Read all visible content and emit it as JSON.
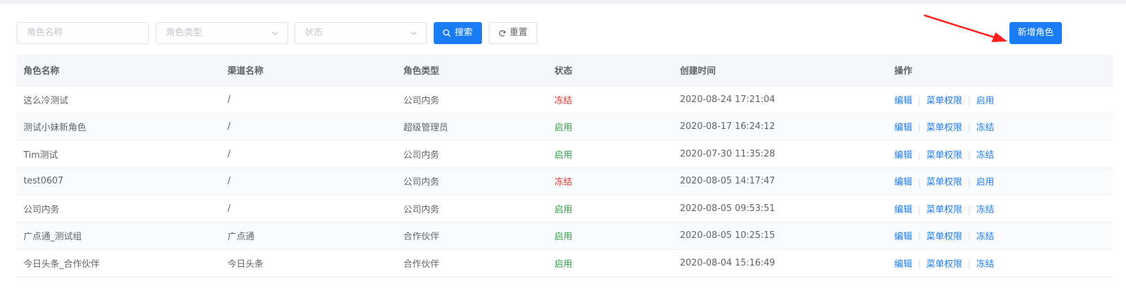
{
  "filters": {
    "role_name_placeholder": "角色名称",
    "role_type_placeholder": "角色类型",
    "status_placeholder": "状态",
    "search_label": "搜索",
    "reset_label": "重置"
  },
  "actions": {
    "add_role_label": "新增角色"
  },
  "colors": {
    "primary": "#1a7cf5",
    "enabled": "#2ea043",
    "frozen": "#e0342c",
    "arrow": "#ff1f1f"
  },
  "table": {
    "columns": [
      "角色名称",
      "渠道名称",
      "角色类型",
      "状态",
      "创建时间",
      "操作"
    ],
    "rows": [
      {
        "name": "这么冷测试",
        "channel": "/",
        "type": "公司内务",
        "status": "冻结",
        "created": "2020-08-24 17:21:04",
        "ops": [
          "编辑",
          "菜单权限",
          "启用"
        ]
      },
      {
        "name": "测试小妹新角色",
        "channel": "/",
        "type": "超级管理员",
        "status": "启用",
        "created": "2020-08-17 16:24:12",
        "ops": [
          "编辑",
          "菜单权限",
          "冻结"
        ]
      },
      {
        "name": "Tim测试",
        "channel": "/",
        "type": "公司内务",
        "status": "启用",
        "created": "2020-07-30 11:35:28",
        "ops": [
          "编辑",
          "菜单权限",
          "冻结"
        ]
      },
      {
        "name": "test0607",
        "channel": "/",
        "type": "公司内务",
        "status": "冻结",
        "created": "2020-08-05 14:17:47",
        "ops": [
          "编辑",
          "菜单权限",
          "启用"
        ]
      },
      {
        "name": "公司内务",
        "channel": "/",
        "type": "公司内务",
        "status": "启用",
        "created": "2020-08-05 09:53:51",
        "ops": [
          "编辑",
          "菜单权限",
          "冻结"
        ]
      },
      {
        "name": "广点通_测试组",
        "channel": "广点通",
        "type": "合作伙伴",
        "status": "启用",
        "created": "2020-08-05 10:25:15",
        "ops": [
          "编辑",
          "菜单权限",
          "冻结"
        ]
      },
      {
        "name": "今日头条_合作伙伴",
        "channel": "今日头条",
        "type": "合作伙伴",
        "status": "启用",
        "created": "2020-08-04 15:16:49",
        "ops": [
          "编辑",
          "菜单权限",
          "冻结"
        ]
      }
    ]
  }
}
